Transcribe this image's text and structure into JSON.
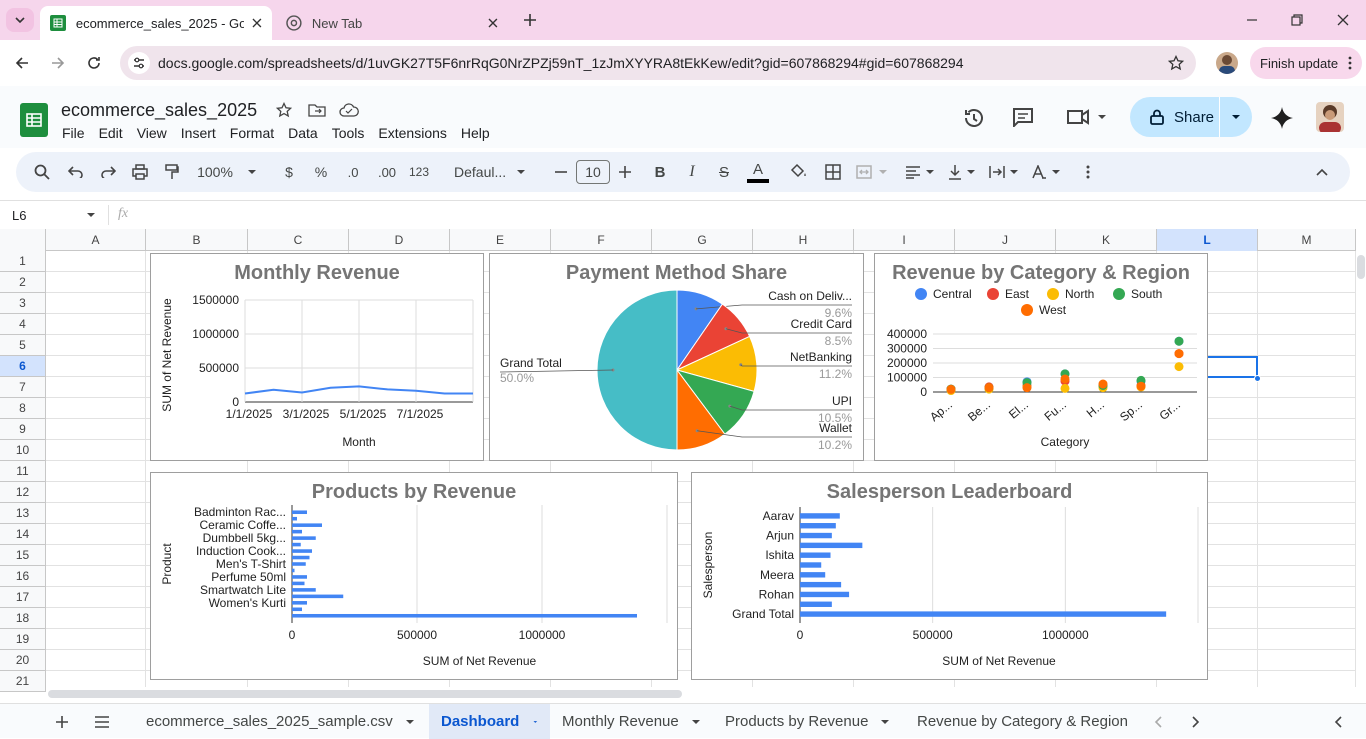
{
  "browser": {
    "tabs": [
      {
        "title": "ecommerce_sales_2025 - Goog",
        "active": true
      },
      {
        "title": "New Tab",
        "active": false
      }
    ],
    "url": "docs.google.com/spreadsheets/d/1uvGK27T5F6nrRqG0NrZPZj59nT_1zJmXYYRA8tEkKew/edit?gid=607868294#gid=607868294",
    "finish_update": "Finish update"
  },
  "doc": {
    "title": "ecommerce_sales_2025",
    "menu": [
      "File",
      "Edit",
      "View",
      "Insert",
      "Format",
      "Data",
      "Tools",
      "Extensions",
      "Help"
    ],
    "share": "Share"
  },
  "toolbar": {
    "zoom": "100%",
    "currency": "$",
    "percent": "%",
    "dec_decrease": ".0",
    "dec_increase": ".00",
    "number_format": "123",
    "font": "Defaul...",
    "font_size": "10",
    "bold": "B",
    "italic": "I",
    "strike": "S",
    "text_color": "A"
  },
  "formula_bar": {
    "cell_ref": "L6",
    "fx": "fx",
    "value": ""
  },
  "grid": {
    "columns": [
      "A",
      "B",
      "C",
      "D",
      "E",
      "F",
      "G",
      "H",
      "I",
      "J",
      "K",
      "L",
      "M"
    ],
    "rows": [
      "1",
      "2",
      "3",
      "4",
      "5",
      "6",
      "7",
      "8",
      "9",
      "10",
      "11",
      "12",
      "13",
      "14",
      "15",
      "16",
      "17",
      "18",
      "19",
      "20",
      "21"
    ],
    "selected_column": "L",
    "selected_row": "6"
  },
  "chart_data": [
    {
      "type": "line",
      "title": "Monthly Revenue",
      "xlabel": "Month",
      "ylabel": "SUM of Net Revenue",
      "x": [
        "1/1/2025",
        "2/1/2025",
        "3/1/2025",
        "4/1/2025",
        "5/1/2025",
        "6/1/2025",
        "7/1/2025",
        "8/1/2025",
        "9/1/2025"
      ],
      "x_tick_labels": [
        "1/1/2025",
        "3/1/2025",
        "5/1/2025",
        "7/1/2025"
      ],
      "values": [
        125000,
        180000,
        140000,
        210000,
        230000,
        185000,
        165000,
        125000,
        125000
      ],
      "ylim": [
        0,
        1500000
      ],
      "y_ticks": [
        "0",
        "500000",
        "1000000",
        "1500000"
      ],
      "color": "#4285f4"
    },
    {
      "type": "pie",
      "title": "Payment Method Share",
      "slices": [
        {
          "label": "Cash on Deliv...",
          "pct": "9.6%",
          "value": 9.6,
          "color": "#4285f4"
        },
        {
          "label": "Credit Card",
          "pct": "8.5%",
          "value": 8.5,
          "color": "#ea4335"
        },
        {
          "label": "NetBanking",
          "pct": "11.2%",
          "value": 11.2,
          "color": "#fbbc04"
        },
        {
          "label": "UPI",
          "pct": "10.5%",
          "value": 10.5,
          "color": "#34a853"
        },
        {
          "label": "Wallet",
          "pct": "10.2%",
          "value": 10.2,
          "color": "#ff6d01"
        },
        {
          "label": "Grand Total",
          "pct": "50.0%",
          "value": 50.0,
          "color": "#46bdc6"
        }
      ]
    },
    {
      "type": "scatter",
      "title": "Revenue by Category & Region",
      "xlabel": "Category",
      "categories": [
        "Ap...",
        "Be...",
        "El...",
        "Fu...",
        "H...",
        "Sp...",
        "Gr..."
      ],
      "series": [
        {
          "name": "Central",
          "color": "#4285f4",
          "values": [
            15000,
            30000,
            70000,
            125000,
            40000,
            75000,
            350000
          ]
        },
        {
          "name": "East",
          "color": "#ea4335",
          "values": [
            20000,
            35000,
            45000,
            75000,
            45000,
            45000,
            265000
          ]
        },
        {
          "name": "North",
          "color": "#fbbc04",
          "values": [
            10000,
            20000,
            35000,
            25000,
            30000,
            35000,
            175000
          ]
        },
        {
          "name": "South",
          "color": "#34a853",
          "values": [
            20000,
            30000,
            65000,
            125000,
            45000,
            80000,
            350000
          ]
        },
        {
          "name": "West",
          "color": "#ff6d01",
          "values": [
            18000,
            30000,
            30000,
            90000,
            55000,
            40000,
            265000
          ]
        }
      ],
      "ylim": [
        0,
        400000
      ],
      "y_ticks": [
        "0",
        "100000",
        "200000",
        "300000",
        "400000"
      ]
    },
    {
      "type": "bar",
      "orientation": "horizontal",
      "title": "Products by Revenue",
      "xlabel": "SUM of Net Revenue",
      "ylabel": "Product",
      "categories": [
        "Badminton Rac...",
        "",
        "Ceramic Coffe...",
        "",
        "Dumbbell 5kg...",
        "",
        "Induction Cook...",
        "",
        "Men's T-Shirt",
        "",
        "Perfume 50ml",
        "",
        "Smartwatch Lite",
        "",
        "Women's Kurti",
        "",
        "Grand Total"
      ],
      "shown_labels": [
        "Badminton Rac...",
        "Ceramic Coffe...",
        "Dumbbell 5kg...",
        "Induction Cook...",
        "Men's T-Shirt",
        "Perfume 50ml",
        "Smartwatch Lite",
        "Women's Kurti"
      ],
      "values": [
        60000,
        20000,
        120000,
        40000,
        95000,
        35000,
        80000,
        70000,
        55000,
        10000,
        60000,
        50000,
        95000,
        205000,
        60000,
        40000,
        1380000
      ],
      "xlim": [
        0,
        1500000
      ],
      "x_ticks": [
        "0",
        "500000",
        "1000000"
      ],
      "color": "#4285f4"
    },
    {
      "type": "bar",
      "orientation": "horizontal",
      "title": "Salesperson Leaderboard",
      "xlabel": "SUM of Net Revenue",
      "ylabel": "Salesperson",
      "categories": [
        "Aarav",
        "",
        "Arjun",
        "",
        "Ishita",
        "",
        "Meera",
        "",
        "Rohan",
        "",
        "Grand Total"
      ],
      "shown_labels": [
        "Aarav",
        "Arjun",
        "Ishita",
        "Meera",
        "Rohan",
        "Grand Total"
      ],
      "values": [
        150000,
        135000,
        120000,
        235000,
        115000,
        80000,
        95000,
        155000,
        185000,
        120000,
        1380000
      ],
      "xlim": [
        0,
        1500000
      ],
      "x_ticks": [
        "0",
        "500000",
        "1000000"
      ],
      "color": "#4285f4"
    }
  ],
  "sheet_tabs": [
    "ecommerce_sales_2025_sample.csv",
    "Dashboard",
    "Monthly Revenue",
    "Products by Revenue",
    "Revenue by Category & Region"
  ],
  "active_sheet": "Dashboard"
}
